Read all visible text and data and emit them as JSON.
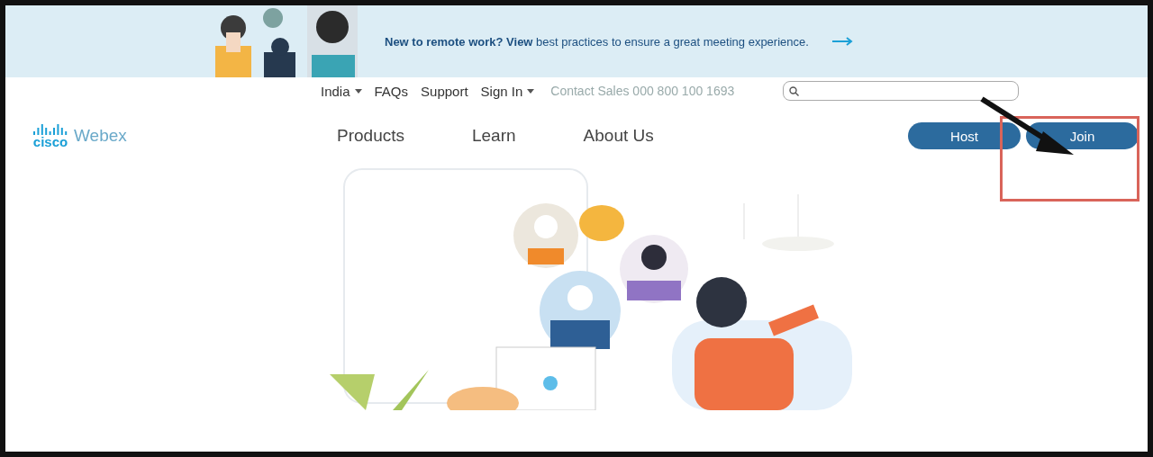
{
  "banner": {
    "text": "**New to remote work? View** best practices to ensure a great meeting experience."
  },
  "utility_nav": {
    "items": [
      {
        "label": "India",
        "dropdown": true
      },
      {
        "label": "FAQs",
        "dropdown": false
      },
      {
        "label": "Support",
        "dropdown": false
      },
      {
        "label": "Sign In",
        "dropdown": true
      }
    ],
    "contact": "Contact Sales 000 800 100 1693"
  },
  "logo": {
    "brand": "cisco",
    "product": "Webex"
  },
  "main_nav": [
    "Products",
    "Learn",
    "About Us"
  ],
  "buttons": [
    {
      "label": "Host",
      "highlighted": false
    },
    {
      "label": "Join",
      "highlighted": true
    }
  ]
}
